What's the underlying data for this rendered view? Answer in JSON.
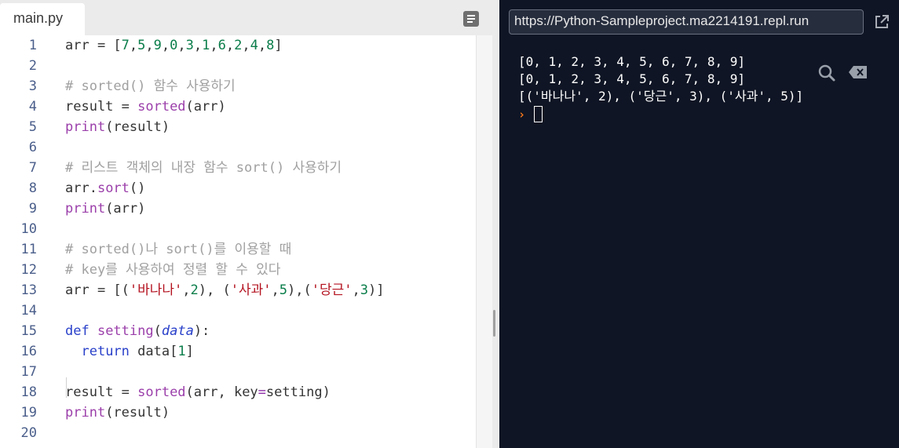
{
  "editor": {
    "tab_label": "main.py",
    "lines": [
      {
        "n": "1",
        "parts": [
          [
            "",
            "arr = ["
          ],
          [
            "k-num",
            "7"
          ],
          [
            "",
            ","
          ],
          [
            "k-num",
            "5"
          ],
          [
            "",
            ","
          ],
          [
            "k-num",
            "9"
          ],
          [
            "",
            ","
          ],
          [
            "k-num",
            "0"
          ],
          [
            "",
            ","
          ],
          [
            "k-num",
            "3"
          ],
          [
            "",
            ","
          ],
          [
            "k-num",
            "1"
          ],
          [
            "",
            ","
          ],
          [
            "k-num",
            "6"
          ],
          [
            "",
            ","
          ],
          [
            "k-num",
            "2"
          ],
          [
            "",
            ","
          ],
          [
            "k-num",
            "4"
          ],
          [
            "",
            ","
          ],
          [
            "k-num",
            "8"
          ],
          [
            "",
            "]"
          ]
        ]
      },
      {
        "n": "2",
        "parts": []
      },
      {
        "n": "3",
        "parts": [
          [
            "k-cm",
            "# sorted() 함수 사용하기"
          ]
        ]
      },
      {
        "n": "4",
        "parts": [
          [
            "",
            "result = "
          ],
          [
            "k-fn",
            "sorted"
          ],
          [
            "",
            "(arr)"
          ]
        ]
      },
      {
        "n": "5",
        "parts": [
          [
            "k-fn",
            "print"
          ],
          [
            "",
            "(result)"
          ]
        ]
      },
      {
        "n": "6",
        "parts": []
      },
      {
        "n": "7",
        "parts": [
          [
            "k-cm",
            "# 리스트 객체의 내장 함수 sort() 사용하기"
          ]
        ]
      },
      {
        "n": "8",
        "parts": [
          [
            "",
            "arr."
          ],
          [
            "k-fn",
            "sort"
          ],
          [
            "",
            "()"
          ]
        ]
      },
      {
        "n": "9",
        "parts": [
          [
            "k-fn",
            "print"
          ],
          [
            "",
            "(arr)"
          ]
        ]
      },
      {
        "n": "10",
        "parts": []
      },
      {
        "n": "11",
        "parts": [
          [
            "k-cm",
            "# sorted()나 sort()를 이용할 때"
          ]
        ]
      },
      {
        "n": "12",
        "parts": [
          [
            "k-cm",
            "# key를 사용하여 정렬 할 수 있다"
          ]
        ]
      },
      {
        "n": "13",
        "parts": [
          [
            "",
            "arr = [("
          ],
          [
            "k-str",
            "'바나나'"
          ],
          [
            "",
            ","
          ],
          [
            "k-num",
            "2"
          ],
          [
            "",
            "), ("
          ],
          [
            "k-str",
            "'사과'"
          ],
          [
            "",
            ","
          ],
          [
            "k-num",
            "5"
          ],
          [
            "",
            "),("
          ],
          [
            "k-str",
            "'당근'"
          ],
          [
            "",
            ","
          ],
          [
            "k-num",
            "3"
          ],
          [
            "",
            ")]"
          ]
        ]
      },
      {
        "n": "14",
        "parts": []
      },
      {
        "n": "15",
        "parts": [
          [
            "k-kw",
            "def "
          ],
          [
            "k-fn",
            "setting"
          ],
          [
            "",
            "("
          ],
          [
            "k-param",
            "data"
          ],
          [
            "",
            "):"
          ]
        ]
      },
      {
        "n": "16",
        "parts": [
          [
            "",
            "  "
          ],
          [
            "k-kw",
            "return"
          ],
          [
            "",
            " data["
          ],
          [
            "k-num",
            "1"
          ],
          [
            "",
            "]"
          ]
        ]
      },
      {
        "n": "17",
        "parts": []
      },
      {
        "n": "18",
        "parts": [
          [
            "",
            "result = "
          ],
          [
            "k-fn",
            "sorted"
          ],
          [
            "",
            "(arr, key"
          ],
          [
            "k-op",
            "="
          ],
          [
            "",
            "setting)"
          ]
        ]
      },
      {
        "n": "19",
        "parts": [
          [
            "k-fn",
            "print"
          ],
          [
            "",
            "(result)"
          ]
        ]
      },
      {
        "n": "20",
        "parts": []
      }
    ]
  },
  "output": {
    "url": "https://Python-Sampleproject.ma2214191.repl.run",
    "lines": [
      "[0, 1, 2, 3, 4, 5, 6, 7, 8, 9]",
      "[0, 1, 2, 3, 4, 5, 6, 7, 8, 9]",
      "[('바나나', 2), ('당근', 3), ('사과', 5)]"
    ],
    "prompt": "›"
  },
  "icons": {
    "menu": "menu-icon",
    "external": "external-link-icon",
    "search": "search-icon",
    "clear": "clear-console-icon"
  },
  "colors": {
    "number": "#0a7d4a",
    "function": "#9b3faa",
    "comment": "#a0a0a0",
    "string": "#b3121f",
    "keyword": "#2940c9",
    "console_bg": "#0f1524",
    "prompt": "#ff7a1a"
  }
}
